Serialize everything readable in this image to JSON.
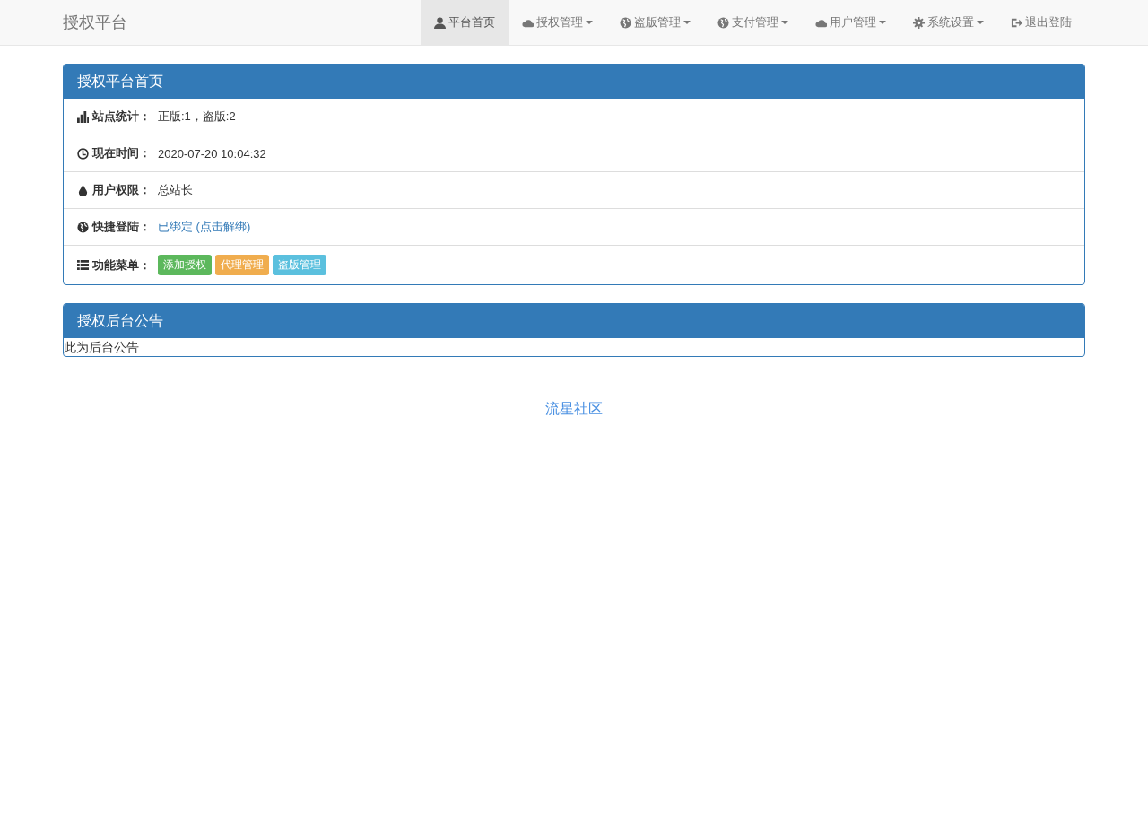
{
  "brand": "授权平台",
  "nav": [
    {
      "label": "平台首页",
      "kind": "user",
      "dropdown": false,
      "selected": true
    },
    {
      "label": "授权管理",
      "kind": "cloud",
      "dropdown": true,
      "selected": false
    },
    {
      "label": "盗版管理",
      "kind": "globe",
      "dropdown": true,
      "selected": false
    },
    {
      "label": "支付管理",
      "kind": "globe",
      "dropdown": true,
      "selected": false
    },
    {
      "label": "用户管理",
      "kind": "cloud",
      "dropdown": true,
      "selected": false
    },
    {
      "label": "系统设置",
      "kind": "gear",
      "dropdown": true,
      "selected": false
    },
    {
      "label": "退出登陆",
      "kind": "signout",
      "dropdown": false,
      "selected": false
    }
  ],
  "home_panel": {
    "title": "授权平台首页",
    "rows": [
      {
        "kind": "chart",
        "label": "站点统计：",
        "link": false,
        "value": "正版:1，盗版:2"
      },
      {
        "kind": "clock",
        "label": "现在时间：",
        "link": false,
        "value": "2020-07-20 10:04:32"
      },
      {
        "kind": "drop",
        "label": "用户权限：",
        "link": false,
        "value": "总站长"
      },
      {
        "kind": "globe",
        "label": "快捷登陆：",
        "link": true,
        "value": "已绑定 (点击解绑)"
      },
      {
        "kind": "list",
        "label": "功能菜单：",
        "tags": [
          {
            "label": "添加授权",
            "color": "#5cb85c"
          },
          {
            "label": "代理管理",
            "color": "#f0ad4e"
          },
          {
            "label": "盗版管理",
            "color": "#5bc0de"
          }
        ]
      }
    ]
  },
  "notice_panel": {
    "title": "授权后台公告",
    "body": "此为后台公告"
  },
  "footer_link": "流星社区"
}
